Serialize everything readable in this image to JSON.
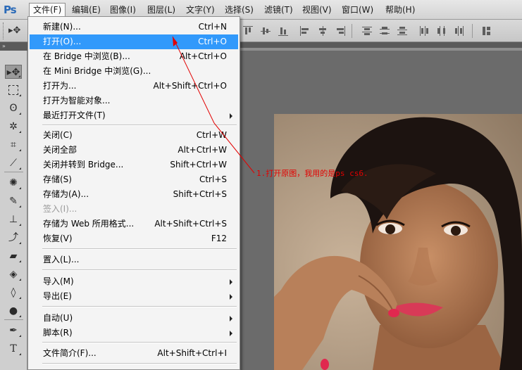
{
  "app": {
    "logo": "Ps"
  },
  "menubar": {
    "items": [
      "文件(F)",
      "编辑(E)",
      "图像(I)",
      "图层(L)",
      "文字(Y)",
      "选择(S)",
      "滤镜(T)",
      "视图(V)",
      "窗口(W)",
      "帮助(H)"
    ],
    "active": "文件(F)"
  },
  "file_menu": {
    "items": [
      {
        "label": "新建(N)...",
        "shortcut": "Ctrl+N"
      },
      {
        "label": "打开(O)...",
        "shortcut": "Ctrl+O",
        "highlighted": true
      },
      {
        "label": "在 Bridge 中浏览(B)...",
        "shortcut": "Alt+Ctrl+O"
      },
      {
        "label": "在 Mini Bridge 中浏览(G)...",
        "shortcut": ""
      },
      {
        "label": "打开为...",
        "shortcut": "Alt+Shift+Ctrl+O"
      },
      {
        "label": "打开为智能对象...",
        "shortcut": ""
      },
      {
        "label": "最近打开文件(T)",
        "shortcut": "",
        "submenu": true
      },
      {
        "label": "关闭(C)",
        "shortcut": "Ctrl+W"
      },
      {
        "label": "关闭全部",
        "shortcut": "Alt+Ctrl+W"
      },
      {
        "label": "关闭并转到 Bridge...",
        "shortcut": "Shift+Ctrl+W"
      },
      {
        "label": "存储(S)",
        "shortcut": "Ctrl+S"
      },
      {
        "label": "存储为(A)...",
        "shortcut": "Shift+Ctrl+S"
      },
      {
        "label": "签入(I)...",
        "shortcut": "",
        "disabled": true
      },
      {
        "label": "存储为 Web 所用格式...",
        "shortcut": "Alt+Shift+Ctrl+S"
      },
      {
        "label": "恢复(V)",
        "shortcut": "F12"
      },
      {
        "label": "置入(L)...",
        "shortcut": ""
      },
      {
        "label": "导入(M)",
        "shortcut": "",
        "submenu": true
      },
      {
        "label": "导出(E)",
        "shortcut": "",
        "submenu": true
      },
      {
        "label": "自动(U)",
        "shortcut": "",
        "submenu": true
      },
      {
        "label": "脚本(R)",
        "shortcut": "",
        "submenu": true
      },
      {
        "label": "文件简介(F)...",
        "shortcut": "Alt+Shift+Ctrl+I"
      }
    ]
  },
  "annotation": {
    "text": "1.打开原图，我用的是ps cs6.",
    "color": "#e20000"
  },
  "colors": {
    "highlight": "#3199fb",
    "menu_bg": "#f4f4f4",
    "workspace": "#6b6b6b"
  },
  "tools": [
    "move-tool",
    "marquee-tool",
    "lasso-tool",
    "quick-selection-tool",
    "crop-tool",
    "eyedropper-tool",
    "spot-healing-tool",
    "brush-tool",
    "clone-stamp-tool",
    "history-brush-tool",
    "eraser-tool",
    "paint-bucket-tool",
    "blur-tool",
    "dodge-tool",
    "pen-tool",
    "type-tool"
  ]
}
